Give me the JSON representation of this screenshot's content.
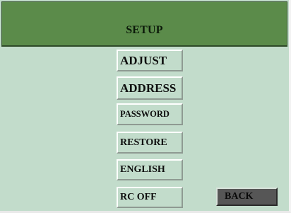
{
  "header": {
    "title": "SETUP"
  },
  "menu": {
    "items": [
      {
        "id": "adjust",
        "label": "ADJUST"
      },
      {
        "id": "address",
        "label": "ADDRESS"
      },
      {
        "id": "password",
        "label": "PASSWORD"
      },
      {
        "id": "restore",
        "label": "RESTORE"
      },
      {
        "id": "english",
        "label": "ENGLISH"
      },
      {
        "id": "rcoff",
        "label": "RC OFF"
      }
    ]
  },
  "back": {
    "label": "BACK"
  },
  "colors": {
    "header_bg": "#5b8b4a",
    "panel_bg": "#c2dccb",
    "back_bg": "#565656",
    "text": "#0e0e0e"
  }
}
